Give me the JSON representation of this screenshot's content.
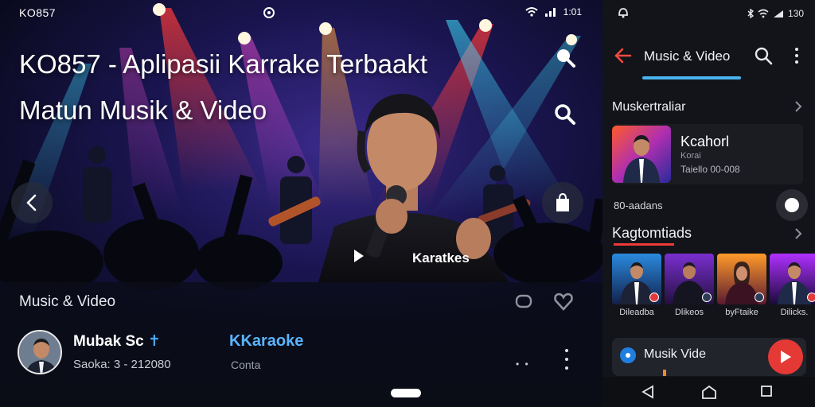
{
  "status_left": {
    "time": "KO857",
    "right_text": "1:01"
  },
  "hero": {
    "title_line1": "KO857 - Aplipasii Karrake Terbaakt",
    "title_line2": "Matun Musik & Video",
    "video_label": "Karatkes"
  },
  "details": {
    "section_title": "Music & Video",
    "channel_name": "Mubak Sc",
    "channel_accent": "✝",
    "channel_sub": "Saoka: 3 - 212080",
    "link_label": "KKaraoke",
    "link_sub": "Conta",
    "dots_text": "• •"
  },
  "status_right": {
    "time": "130"
  },
  "appbar": {
    "title": "Music & Video"
  },
  "sections": {
    "featured_title": "Muskertraliar",
    "categories_title": "Kagtomtiads"
  },
  "featured": {
    "title": "Kcahorl",
    "sub1": "Korai",
    "sub2": "Taiello 00-008"
  },
  "meta": {
    "line": "80-aadans"
  },
  "thumbs": [
    {
      "caption": "Dileadba",
      "badge": "red"
    },
    {
      "caption": "Dlikeos",
      "badge": "red"
    },
    {
      "caption": "byFtaike",
      "badge": "white"
    },
    {
      "caption": "Dilicks.",
      "badge": "red"
    }
  ],
  "mini_player": {
    "title": "Musik Vide"
  },
  "colors": {
    "accent_blue": "#49b2ef",
    "accent_red": "#e53935",
    "link_blue": "#5ab4ff",
    "background": "#131419"
  },
  "icons": [
    "search-icon",
    "back-arrow-icon",
    "more-vert-icon",
    "play-icon",
    "bag-icon",
    "home-icon",
    "recents-icon"
  ]
}
